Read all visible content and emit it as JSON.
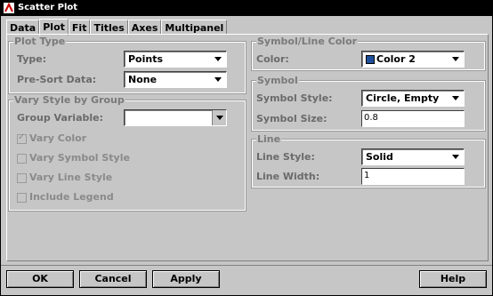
{
  "window": {
    "title": "Scatter Plot"
  },
  "tabs": [
    "Data",
    "Plot",
    "Fit",
    "Titles",
    "Axes",
    "Multipanel"
  ],
  "plot_type": {
    "header": "Plot Type",
    "type_label": "Type:",
    "type_value": "Points",
    "presort_label": "Pre-Sort Data:",
    "presort_value": "None"
  },
  "vary_style": {
    "header": "Vary Style by Group",
    "group_label": "Group Variable:",
    "group_value": "",
    "vary_color": "Vary Color",
    "vary_symbol": "Vary Symbol Style",
    "vary_line": "Vary Line Style",
    "include_legend": "Include Legend"
  },
  "symbol_line_color": {
    "header": "Symbol/Line Color",
    "color_label": "Color:",
    "color_value": "Color 2",
    "swatch_color": "#1f4f9a"
  },
  "symbol": {
    "header": "Symbol",
    "style_label": "Symbol Style:",
    "style_value": "Circle, Empty",
    "size_label": "Symbol Size:",
    "size_value": "0.8"
  },
  "line": {
    "header": "Line",
    "style_label": "Line Style:",
    "style_value": "Solid",
    "width_label": "Line Width:",
    "width_value": "1"
  },
  "buttons": {
    "ok": "OK",
    "cancel": "Cancel",
    "apply": "Apply",
    "help": "Help"
  }
}
